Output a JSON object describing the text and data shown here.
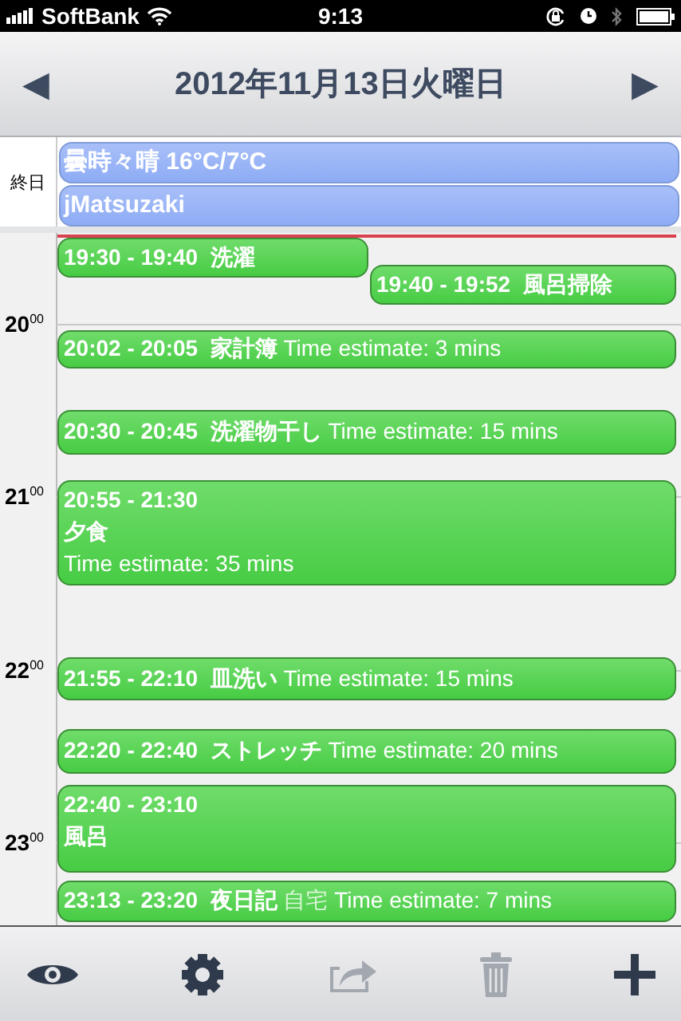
{
  "status_bar": {
    "carrier": "SoftBank",
    "time": "9:13"
  },
  "nav": {
    "prev": "◀",
    "title": "2012年11月13日火曜日",
    "next": "▶"
  },
  "all_day": {
    "label": "終日",
    "events": [
      {
        "title": "曇時々晴 16°C/7°C"
      },
      {
        "title": "jMatsuzaki"
      }
    ]
  },
  "hours": [
    {
      "hour": "20",
      "minutes": "00"
    },
    {
      "hour": "21",
      "minutes": "00"
    },
    {
      "hour": "22",
      "minutes": "00"
    },
    {
      "hour": "23",
      "minutes": "00"
    }
  ],
  "events": [
    {
      "kind": "inline",
      "time": "19:30 - 19:40",
      "title": "洗濯"
    },
    {
      "kind": "inline",
      "time": "19:40 - 19:52",
      "title": "風呂掃除"
    },
    {
      "kind": "inline",
      "time": "20:02 - 20:05",
      "title": "家計簿",
      "note": "Time estimate: 3 mins"
    },
    {
      "kind": "inline",
      "time": "20:30 - 20:45",
      "title": "洗濯物干し",
      "note": "Time estimate: 15 mins"
    },
    {
      "kind": "stacked",
      "time": "20:55 - 21:30",
      "title": "夕食",
      "note": "Time estimate: 35 mins"
    },
    {
      "kind": "inline",
      "time": "21:55 - 22:10",
      "title": "皿洗い",
      "note": "Time estimate: 15 mins"
    },
    {
      "kind": "inline",
      "time": "22:20 - 22:40",
      "title": "ストレッチ",
      "note": "Time estimate: 20 mins"
    },
    {
      "kind": "stacked",
      "time": "22:40 - 23:10",
      "title": "風呂"
    },
    {
      "kind": "inline",
      "time": "23:13 - 23:20",
      "title": "夜日記",
      "location": "自宅",
      "note": "Time estimate: 7 mins"
    }
  ],
  "toolbar": [
    {
      "kind": "eye",
      "disabled": false
    },
    {
      "kind": "gear",
      "disabled": false
    },
    {
      "kind": "share",
      "disabled": true
    },
    {
      "kind": "trash",
      "disabled": true
    },
    {
      "kind": "plus",
      "disabled": false
    }
  ]
}
